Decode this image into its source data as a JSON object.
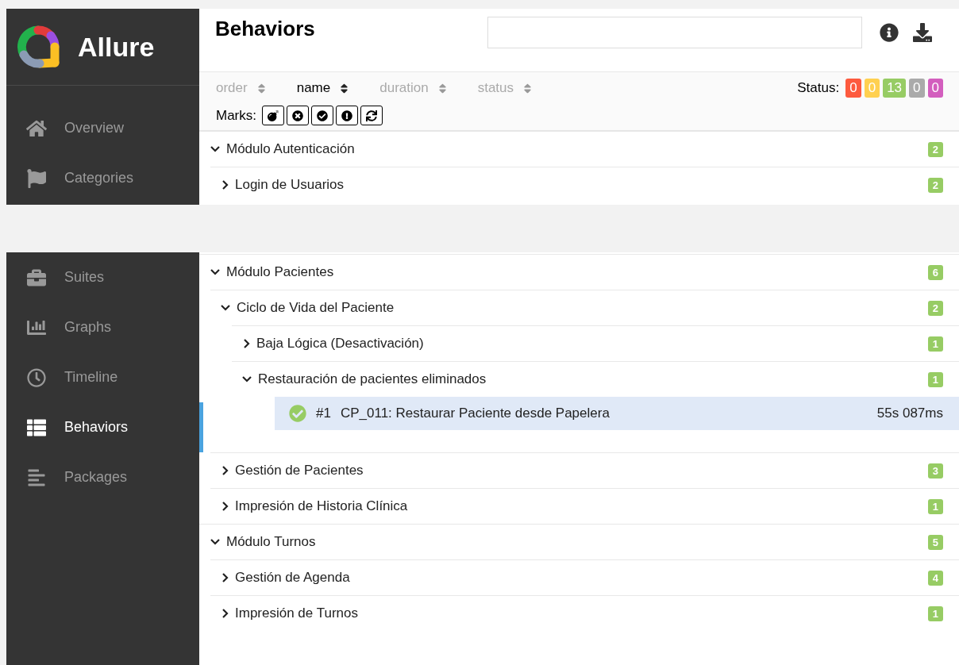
{
  "top": {
    "logo": {
      "text": "Allure"
    },
    "nav": [
      {
        "label": "Overview",
        "selected": false
      },
      {
        "label": "Categories",
        "selected": false
      }
    ],
    "header": {
      "title": "Behaviors"
    },
    "sort": [
      {
        "label": "order",
        "selected": false
      },
      {
        "label": "name",
        "selected": true
      },
      {
        "label": "duration",
        "selected": false
      },
      {
        "label": "status",
        "selected": false
      }
    ],
    "status": {
      "label": "Status:",
      "counts": [
        {
          "value": "0",
          "color": "#fd5a3e"
        },
        {
          "value": "0",
          "color": "#ffd050"
        },
        {
          "value": "13",
          "color": "#97cc64"
        },
        {
          "value": "0",
          "color": "#aaaaaa"
        },
        {
          "value": "0",
          "color": "#d35ebe"
        }
      ]
    },
    "marks": {
      "label": "Marks:"
    },
    "tree": [
      {
        "name": "Módulo Autenticación",
        "count": "2",
        "expanded": true,
        "children": [
          {
            "name": "Login de Usuarios",
            "count": "2",
            "expanded": false
          }
        ]
      }
    ]
  },
  "bottom": {
    "nav": [
      {
        "label": "Suites",
        "selected": false
      },
      {
        "label": "Graphs",
        "selected": false
      },
      {
        "label": "Timeline",
        "selected": false
      },
      {
        "label": "Behaviors",
        "selected": true
      },
      {
        "label": "Packages",
        "selected": false
      }
    ],
    "tree": [
      {
        "name": "Módulo Pacientes",
        "count": "6",
        "expanded": true,
        "children": [
          {
            "name": "Ciclo de Vida del Paciente",
            "count": "2",
            "expanded": true,
            "children": [
              {
                "name": "Baja Lógica (Desactivación)",
                "count": "1",
                "expanded": false
              },
              {
                "name": "Restauración de pacientes eliminados",
                "count": "1",
                "expanded": true,
                "tests": [
                  {
                    "number": "#1",
                    "name": "CP_011: Restaurar Paciente desde Papelera",
                    "duration": "55s 087ms",
                    "selected": true
                  }
                ]
              }
            ]
          },
          {
            "name": "Gestión de Pacientes",
            "count": "3",
            "expanded": false
          },
          {
            "name": "Impresión de Historia Clínica",
            "count": "1",
            "expanded": false
          }
        ]
      },
      {
        "name": "Módulo Turnos",
        "count": "5",
        "expanded": true,
        "children": [
          {
            "name": "Gestión de Agenda",
            "count": "4",
            "expanded": false
          },
          {
            "name": "Impresión de Turnos",
            "count": "1",
            "expanded": false
          }
        ]
      }
    ]
  }
}
